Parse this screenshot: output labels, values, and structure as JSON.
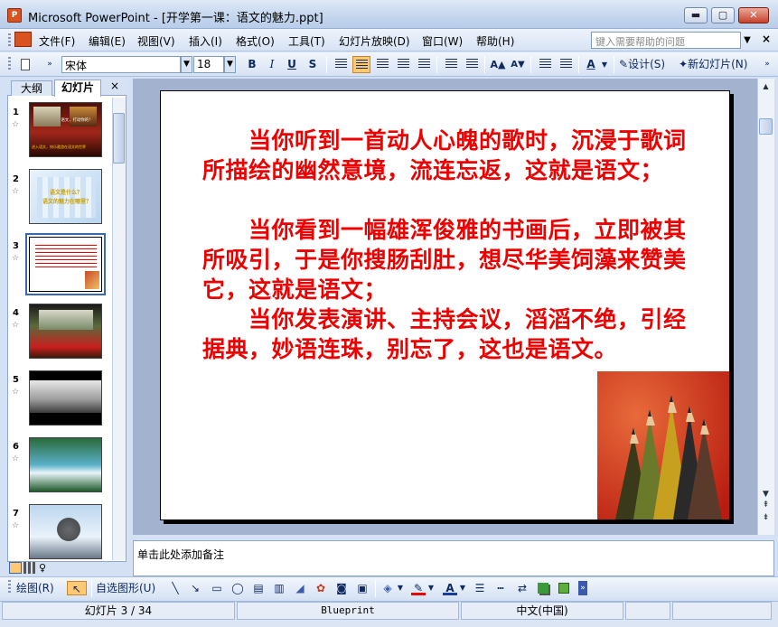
{
  "window": {
    "title": "Microsoft PowerPoint - [开学第一课：语文的魅力.ppt]",
    "minimize": "▭",
    "restore": "□",
    "close": "✕"
  },
  "menu": {
    "items": [
      "文件(F)",
      "编辑(E)",
      "视图(V)",
      "插入(I)",
      "格式(O)",
      "工具(T)",
      "幻灯片放映(D)",
      "窗口(W)",
      "帮助(H)"
    ],
    "help_placeholder": "键入需要帮助的问题",
    "close_doc": "×"
  },
  "format_toolbar": {
    "font": "宋体",
    "size": "18",
    "bold": "B",
    "italic": "I",
    "underline": "U",
    "shadow": "S",
    "grow": "A▲",
    "shrink": "A▼",
    "font_color": "A",
    "design": "设计(S)",
    "new_slide": "新幻灯片(N)"
  },
  "outline_pane": {
    "tab_outline": "大纲",
    "tab_slides": "幻灯片",
    "close": "×",
    "slides": [
      {
        "num": "1",
        "text": "语文，打动你的！",
        "sub": "进入语文，快乐遨游在语文的世界"
      },
      {
        "num": "2",
        "text": "语文是什么？",
        "sub": "语文的魅力在哪里？"
      },
      {
        "num": "3"
      },
      {
        "num": "4"
      },
      {
        "num": "5"
      },
      {
        "num": "6"
      },
      {
        "num": "7"
      }
    ],
    "selected": 3
  },
  "slide": {
    "paragraphs": [
      "　　当你听到一首动人心魄的歌时，沉浸于歌词所描绘的幽然意境，流连忘返，这就是语文；",
      "　　当你看到一幅雄浑俊雅的书画后，立即被其所吸引，于是你搜肠刮肚，想尽华美饲藻来赞美它，这就是语文；",
      "　　当你发表演讲、主持会议，滔滔不绝，引经据典，妙语连珠，别忘了，这也是语文。"
    ]
  },
  "notes": {
    "placeholder": "单击此处添加备注"
  },
  "draw_toolbar": {
    "draw": "绘图(R)",
    "autoshapes": "自选图形(U)"
  },
  "status": {
    "slide": "幻灯片 3 / 34",
    "design": "Blueprint",
    "language": "中文(中国)"
  },
  "colors": {
    "slide_text": "#ee0000",
    "accent": "#3868b0",
    "status_bg": "#dbe5f3"
  }
}
